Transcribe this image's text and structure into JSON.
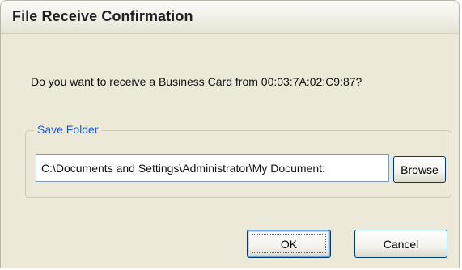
{
  "dialog": {
    "title": "File Receive Confirmation",
    "prompt": "Do you want to receive a Business Card from 00:03:7A:02:C9:87?"
  },
  "save_folder": {
    "legend": "Save Folder",
    "path_value": "C:\\Documents and Settings\\Administrator\\My Document:",
    "browse_label": "Browse"
  },
  "buttons": {
    "ok_label": "OK",
    "cancel_label": "Cancel"
  },
  "colors": {
    "dialog_background": "#ece9d8",
    "legend_text": "#1c5cdc",
    "button_border": "#003c74"
  }
}
